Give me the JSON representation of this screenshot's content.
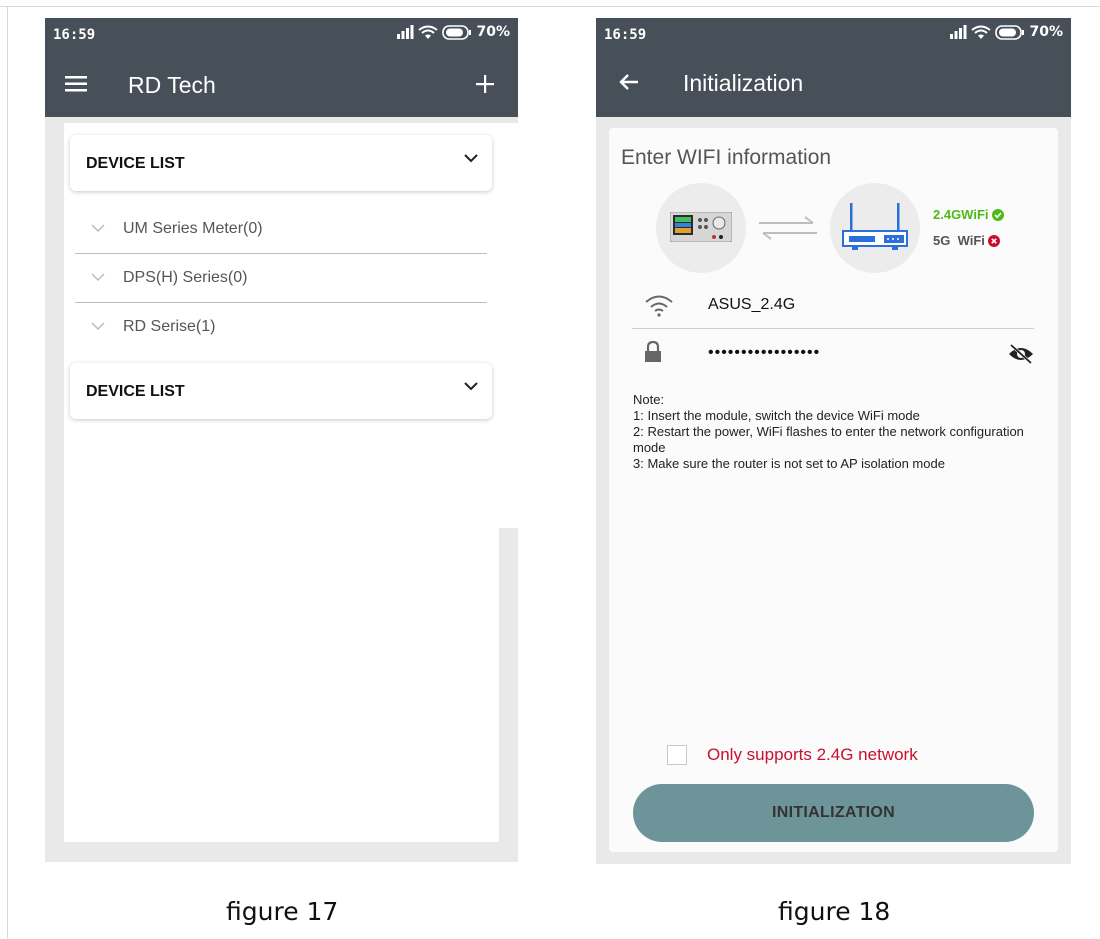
{
  "colors": {
    "appbar": "#475059",
    "background": "#e9e9e9",
    "accent_green": "#4cbb17",
    "error_red": "#c8102e",
    "button": "#6d9499"
  },
  "screen1": {
    "status": {
      "time": "16:59",
      "battery": "70%"
    },
    "appbar": {
      "title": "RD Tech",
      "menu_icon": "hamburger-menu-icon",
      "add_icon": "plus-icon"
    },
    "device_list_label": "DEVICE LIST",
    "series": [
      {
        "label": "UM Series Meter(0)"
      },
      {
        "label": "DPS(H) Series(0)"
      },
      {
        "label": "RD Serise(1)"
      }
    ],
    "device_list_label_2": "DEVICE LIST"
  },
  "screen2": {
    "status": {
      "time": "16:59",
      "battery": "70%"
    },
    "appbar": {
      "title": "Initialization",
      "back_icon": "back-arrow-icon"
    },
    "heading": "Enter WIFI information",
    "wifi_24_label": "2.4GWiFi",
    "wifi_5g_label": "5G  WiFi",
    "ssid": "ASUS_2.4G",
    "password_masked": "•••••••••••••••••",
    "notes": [
      "Note:",
      "1: Insert the module, switch the device WiFi mode",
      "2: Restart the power, WiFi flashes to enter the network configuration mode",
      "3: Make sure the router is not set to AP isolation mode"
    ],
    "checkbox_label": "Only supports 2.4G network",
    "button_label": "INITIALIZATION"
  },
  "captions": {
    "left": "figure 17",
    "right": "figure 18"
  }
}
